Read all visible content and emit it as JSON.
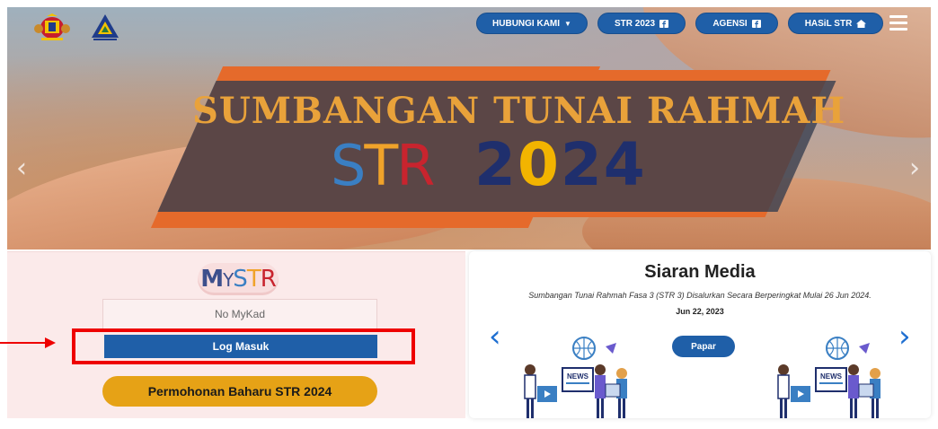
{
  "nav": {
    "buttons": [
      {
        "label": "HUBUNGI KAMI",
        "icon": "caret-down-icon"
      },
      {
        "label": "STR 2023",
        "icon": "facebook-icon"
      },
      {
        "label": "AGENSI",
        "icon": "facebook-icon"
      },
      {
        "label": "HASiL STR",
        "icon": "home-icon"
      }
    ],
    "menu_icon": "hamburger-menu-icon"
  },
  "hero": {
    "title": "SUMBANGAN TUNAI RAHMAH",
    "logo_letters": [
      "S",
      "T",
      "R"
    ],
    "year_parts": [
      "2",
      "0",
      "24"
    ]
  },
  "login": {
    "logo_parts": [
      "M",
      "Y",
      "S",
      "T",
      "R"
    ],
    "mykad_placeholder": "No MyKad",
    "login_label": "Log Masuk",
    "apply_label": "Permohonan Baharu STR 2024"
  },
  "media": {
    "title": "Siaran Media",
    "description": "Sumbangan Tunai Rahmah Fasa 3 (STR 3) Disalurkan Secara Berperingkat Mulai 26 Jun 2024.",
    "date": "Jun 22, 2023",
    "view_label": "Papar",
    "news_sign": "NEWS"
  },
  "colors": {
    "primary_blue": "#1f5fa8",
    "accent_yellow": "#e6a216",
    "highlight_red": "#ee0000",
    "banner_orange": "#e56a2b",
    "title_gold": "#e9a23a"
  }
}
